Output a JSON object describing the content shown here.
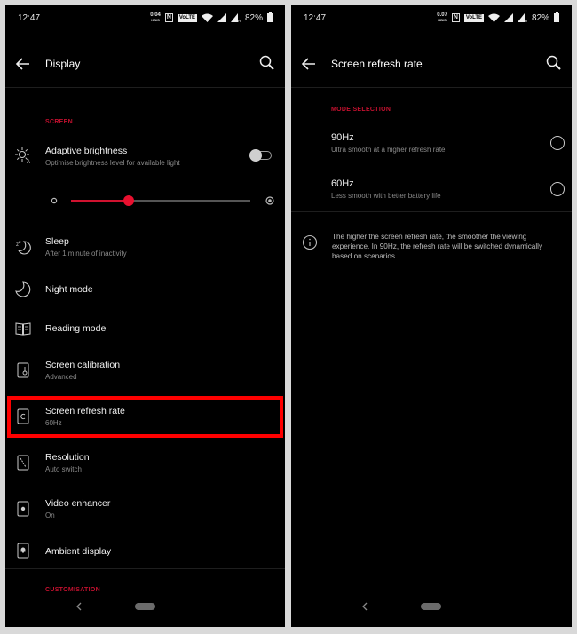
{
  "left": {
    "status_bar": {
      "time": "12:47",
      "net_speed": "0.04",
      "net_unit": "KB/S",
      "nfc": "N",
      "volte": "VoLTE",
      "battery": "82%"
    },
    "app_bar": {
      "title": "Display"
    },
    "sections": [
      {
        "label": "SCREEN"
      },
      {
        "label": "CUSTOMISATION"
      }
    ],
    "adaptive_brightness": {
      "label": "Adaptive brightness",
      "sub": "Optimise brightness level for available light",
      "toggle_on": false
    },
    "brightness_level": 0.32,
    "items": [
      {
        "label": "Sleep",
        "sub": "After 1 minute of inactivity",
        "icon": "sleep-icon"
      },
      {
        "label": "Night mode",
        "icon": "moon-icon"
      },
      {
        "label": "Reading mode",
        "icon": "book-icon"
      },
      {
        "label": "Screen calibration",
        "sub": "Advanced",
        "icon": "screen-calibration-icon"
      },
      {
        "label": "Screen refresh rate",
        "sub": "60Hz",
        "icon": "refresh-rate-icon"
      },
      {
        "label": "Resolution",
        "sub": "Auto switch",
        "icon": "resolution-icon"
      },
      {
        "label": "Video enhancer",
        "sub": "On",
        "icon": "video-enhancer-icon"
      },
      {
        "label": "Ambient display",
        "icon": "ambient-display-icon"
      }
    ],
    "highlight_color": "#ff0000"
  },
  "right": {
    "status_bar": {
      "time": "12:47",
      "net_speed": "0.07",
      "net_unit": "KB/S",
      "nfc": "N",
      "volte": "VoLTE",
      "battery": "82%"
    },
    "app_bar": {
      "title": "Screen refresh rate"
    },
    "section": {
      "label": "MODE SELECTION"
    },
    "options": [
      {
        "label": "90Hz",
        "sub": "Ultra smooth at a higher refresh rate",
        "selected": false
      },
      {
        "label": "60Hz",
        "sub": "Less smooth with better battery life",
        "selected": false
      }
    ],
    "info_text": "The higher the screen refresh rate, the smoother the viewing experience. In 90Hz, the refresh rate will be switched dynamically based on scenarios."
  },
  "colors": {
    "accent": "#d0122f",
    "background": "#000000",
    "frame": "#d9d9d9"
  }
}
